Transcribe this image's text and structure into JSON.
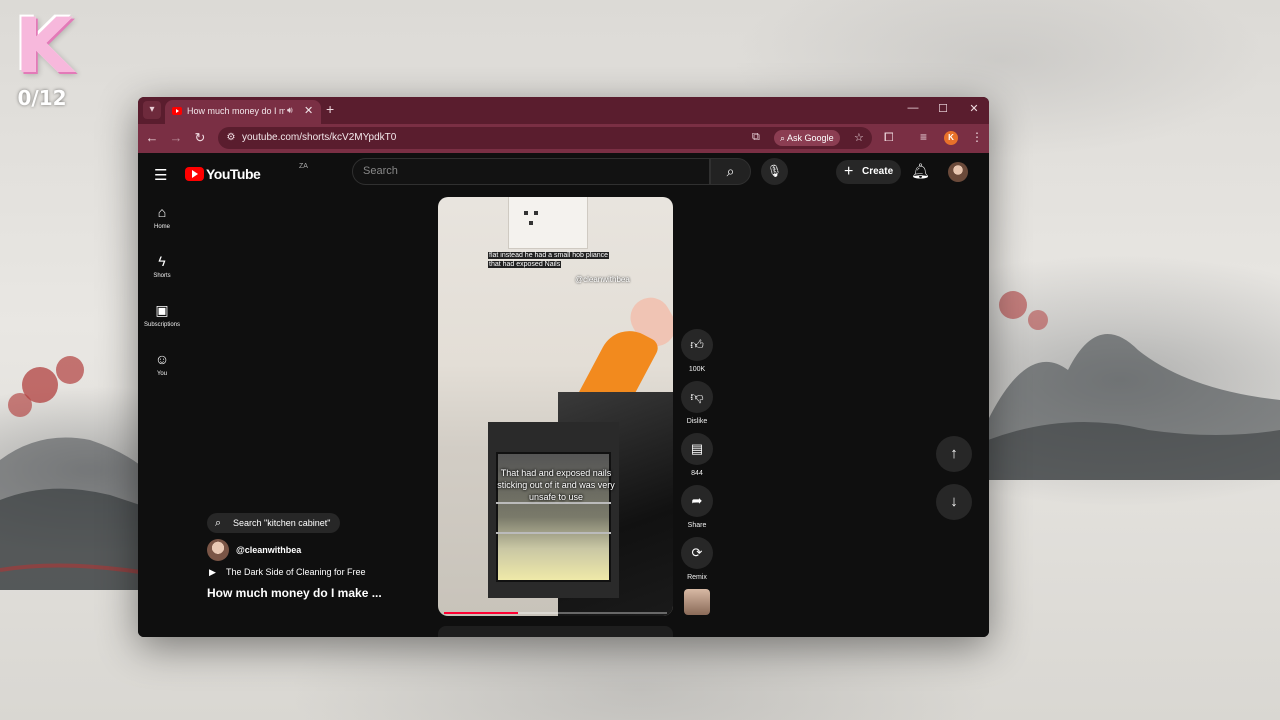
{
  "desktop": {
    "overlay_logo_letter": "K",
    "overlay_counter": "0/12"
  },
  "browser": {
    "tab": {
      "title": "How much money do I make",
      "audio_icon": "speaker-icon",
      "close_icon": "close-icon"
    },
    "new_tab_icon": "plus-icon",
    "url": "youtube.com/shorts/kcV2MYpdkT0",
    "ask_google_label": "Ask Google",
    "profile_initial": "K",
    "theme_color": "#7a2f44"
  },
  "youtube": {
    "logo_text": "YouTube",
    "country_code": "ZA",
    "search_placeholder": "Search",
    "create_label": "Create",
    "sidebar": [
      {
        "label": "Home",
        "icon": "home-icon"
      },
      {
        "label": "Shorts",
        "icon": "shorts-icon"
      },
      {
        "label": "Subscriptions",
        "icon": "subscriptions-icon"
      },
      {
        "label": "You",
        "icon": "you-icon"
      }
    ],
    "video": {
      "overlay_text_line1": "flat instead he had a small hob pliance",
      "overlay_text_line2": "that had exposed Nails",
      "watermark": "@cleanwithbea",
      "caption": "That had and exposed nails sticking out of it and was very unsafe to use",
      "progress": 0.33
    },
    "actions": [
      {
        "label": "100K",
        "icon": "like-icon"
      },
      {
        "label": "Dislike",
        "icon": "dislike-icon"
      },
      {
        "label": "844",
        "icon": "comment-icon"
      },
      {
        "label": "Share",
        "icon": "share-icon"
      },
      {
        "label": "Remix",
        "icon": "remix-icon"
      }
    ],
    "info": {
      "search_chip": "Search \"kitchen cabinet\"",
      "channel": "@cleanwithbea",
      "playlist": "The Dark Side of Cleaning for Free",
      "title": "How much money do I make ..."
    },
    "accent_color": "#ff0033"
  }
}
